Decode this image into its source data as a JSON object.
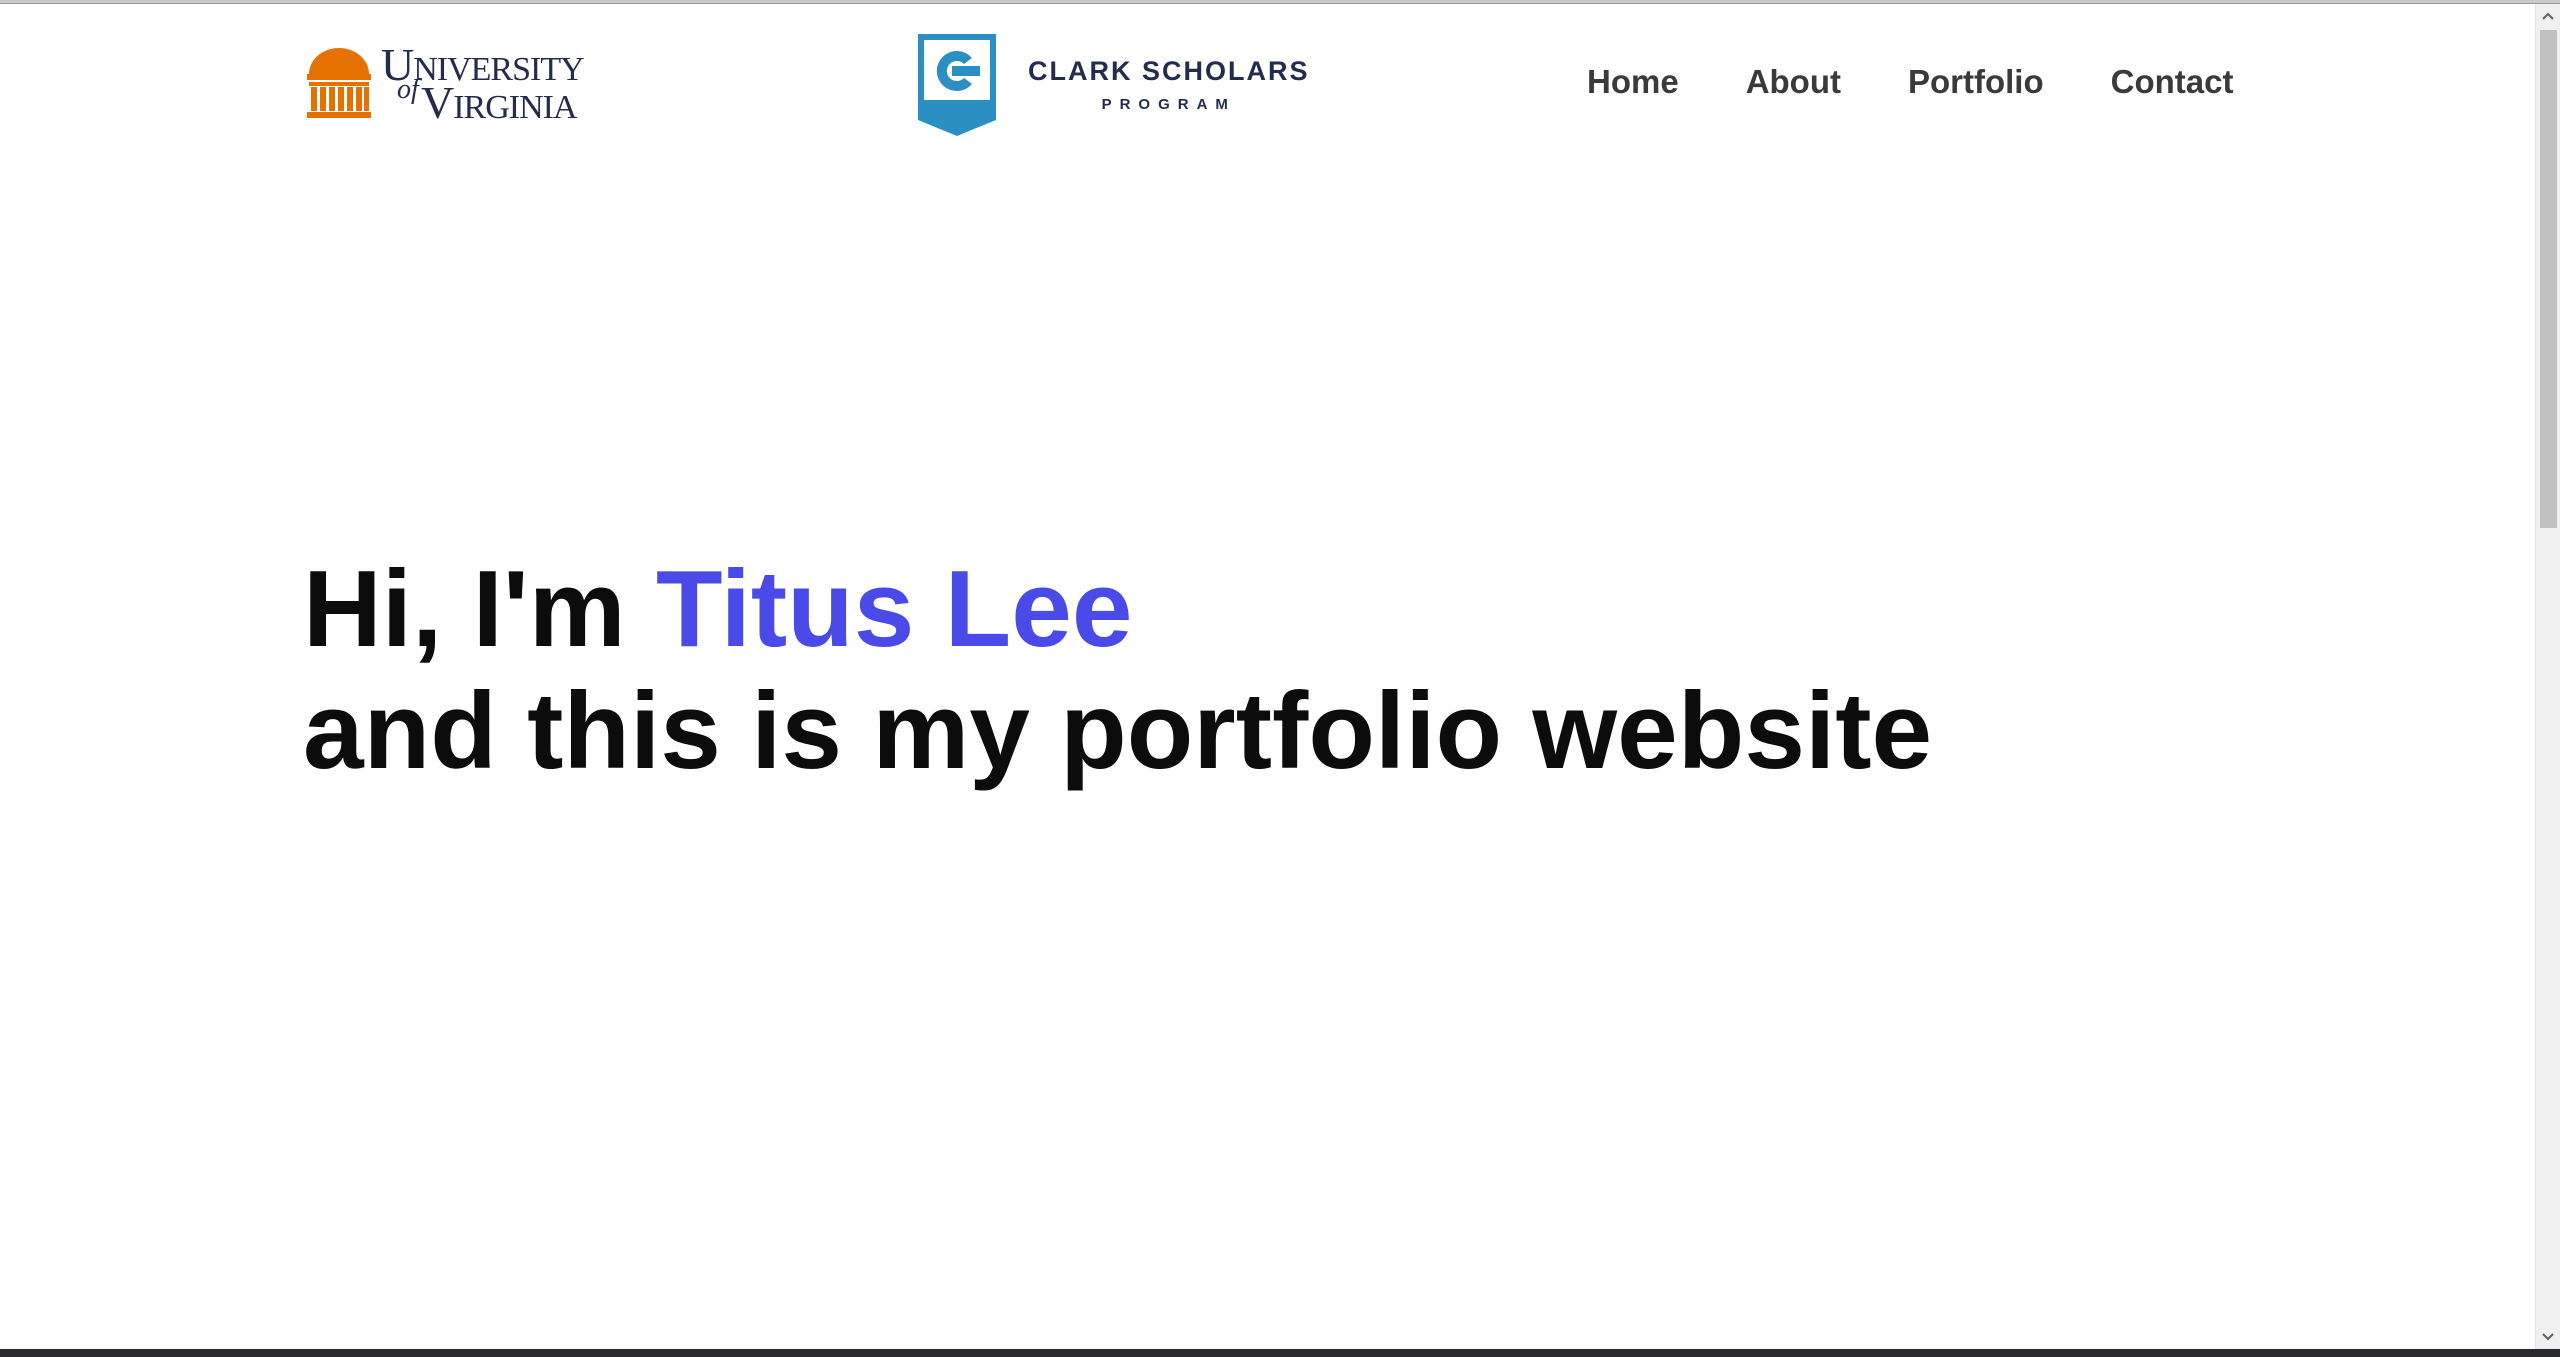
{
  "header": {
    "uva_logo": {
      "line1_initial": "U",
      "line1_rest": "NIVERSITY",
      "line2_of": "of",
      "line2_initial": "V",
      "line2_rest": "IRGINIA",
      "colors": {
        "rotunda": "#e57200",
        "text": "#232d4b"
      }
    },
    "clark_logo": {
      "title": "CLARK SCHOLARS",
      "subtitle": "PROGRAM",
      "colors": {
        "shield": "#2b8fc4",
        "text": "#232d4b"
      }
    },
    "nav": {
      "items": [
        {
          "label": "Home"
        },
        {
          "label": "About"
        },
        {
          "label": "Portfolio"
        },
        {
          "label": "Contact"
        }
      ]
    }
  },
  "hero": {
    "greeting": "Hi, I'm ",
    "name": "Titus Lee",
    "subline": "and this is my portfolio website",
    "colors": {
      "text": "#0c0c0c",
      "name": "#4a4ae8"
    }
  },
  "icons": {
    "scroll_up": "chevron-up-icon",
    "scroll_down": "chevron-down-icon"
  }
}
